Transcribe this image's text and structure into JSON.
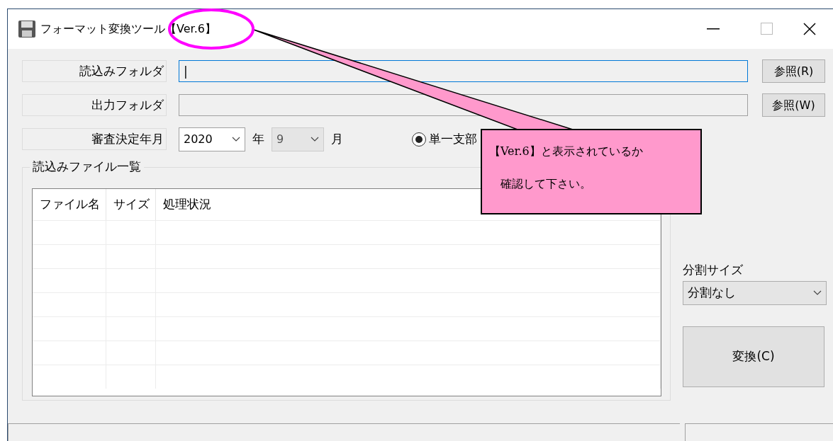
{
  "window": {
    "title": "フォーマット変換ツール【Ver.6】"
  },
  "folders": [
    {
      "label": "読込みフォルダ",
      "value": "|",
      "focused": true,
      "button": "参照(R)"
    },
    {
      "label": "出力フォルダ",
      "focused": false,
      "button": "参照(W)"
    }
  ],
  "date_row": {
    "label": "審査決定年月",
    "year": {
      "value": "2020",
      "disabled": false
    },
    "year_unit": "年",
    "month": {
      "value": "9",
      "disabled": true
    },
    "month_unit": "月"
  },
  "radios": [
    {
      "label": "単一支部",
      "selected": true
    }
  ],
  "file_list": {
    "title": "読込みファイル一覧",
    "columns": [
      "ファイル名",
      "サイズ",
      "処理状況"
    ]
  },
  "split_size": {
    "label": "分割サイズ",
    "value": "分割なし"
  },
  "convert_button": "変換(C)",
  "callout": {
    "lines": [
      "【Ver.6】と表示されているか",
      "確認して下さい。"
    ]
  }
}
